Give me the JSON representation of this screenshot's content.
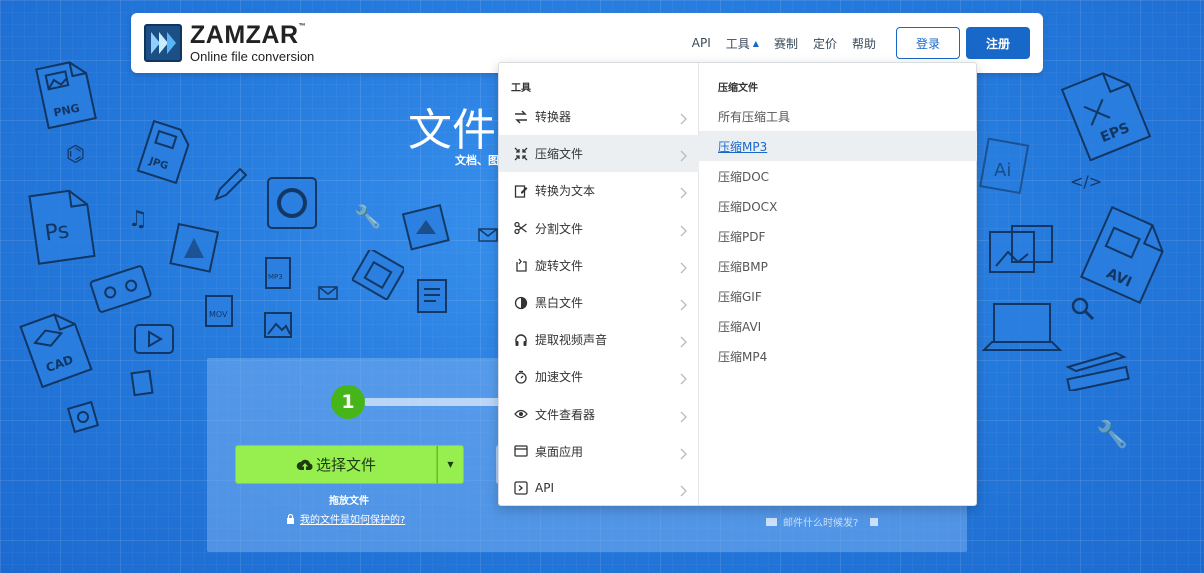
{
  "header": {
    "logo_name": "ZAMZAR",
    "logo_tm": "™",
    "logo_tagline": "Online file conversion",
    "nav": [
      {
        "label": "API",
        "has_caret": false
      },
      {
        "label": "工具",
        "has_caret": true
      },
      {
        "label": "赛制",
        "has_caret": false
      },
      {
        "label": "定价",
        "has_caret": false
      },
      {
        "label": "帮助",
        "has_caret": false
      }
    ],
    "login_label": "登录",
    "signup_label": "注册"
  },
  "hero": {
    "title": "文件",
    "subtitle": "文档、图"
  },
  "converter": {
    "step_number": "1",
    "choose_label": "选择文件",
    "drop_label": "拖放文件",
    "protect_link": "我的文件是如何保护的?",
    "email_hint": "邮件什么时候发?"
  },
  "dropdown": {
    "tools_heading": "工具",
    "tools": [
      {
        "label": "转换器",
        "icon": "arrows-swap-icon",
        "active": false
      },
      {
        "label": "压缩文件",
        "icon": "compress-icon",
        "active": true
      },
      {
        "label": "转换为文本",
        "icon": "edit-doc-icon",
        "active": false
      },
      {
        "label": "分割文件",
        "icon": "scissors-icon",
        "active": false
      },
      {
        "label": "旋转文件",
        "icon": "rotate-icon",
        "active": false
      },
      {
        "label": "黑白文件",
        "icon": "contrast-icon",
        "active": false
      },
      {
        "label": "提取视频声音",
        "icon": "headphones-icon",
        "active": false
      },
      {
        "label": "加速文件",
        "icon": "stopwatch-icon",
        "active": false
      },
      {
        "label": "文件查看器",
        "icon": "eye-icon",
        "active": false
      },
      {
        "label": "桌面应用",
        "icon": "window-icon",
        "active": false
      },
      {
        "label": "API",
        "icon": "terminal-icon",
        "active": false
      }
    ],
    "compress_heading": "压缩文件",
    "compress_items": [
      {
        "label": "所有压缩工具",
        "active": false
      },
      {
        "label": "压缩MP3",
        "active": true
      },
      {
        "label": "压缩DOC",
        "active": false
      },
      {
        "label": "压缩DOCX",
        "active": false
      },
      {
        "label": "压缩PDF",
        "active": false
      },
      {
        "label": "压缩BMP",
        "active": false
      },
      {
        "label": "压缩GIF",
        "active": false
      },
      {
        "label": "压缩AVI",
        "active": false
      },
      {
        "label": "压缩MP4",
        "active": false
      }
    ]
  },
  "doodles": {
    "png": "PNG",
    "jpg": "JPG",
    "ps": "Ps",
    "cad": "CAD",
    "eps": "EPS",
    "ai": "Ai",
    "avi": "AVI",
    "mp3": "MP3",
    "mov": "MOV"
  },
  "colors": {
    "brand_blue": "#1768c9",
    "upload_green": "#97ef4f",
    "step_green": "#46b51a",
    "background": "#2a7fe0"
  }
}
